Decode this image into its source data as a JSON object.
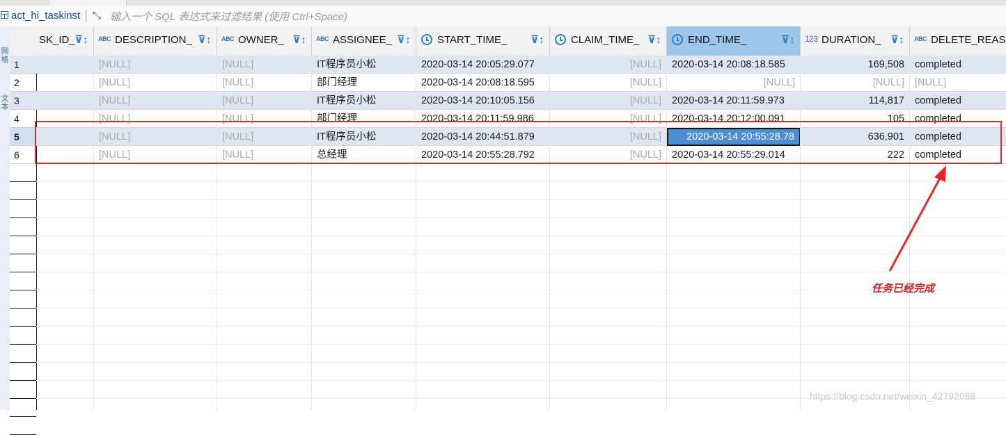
{
  "filter_bar": {
    "table_name": "act_hi_taskinst",
    "expand_icon": "expand-icon",
    "placeholder": "输入一个 SQL 表达式来过滤结果 (使用 Ctrl+Space)"
  },
  "sidebar": {
    "tab_1": "网格",
    "tab_2": "文本"
  },
  "columns": [
    {
      "name": "SK_ID_",
      "type": "text"
    },
    {
      "name": "DESCRIPTION_",
      "type": "text",
      "type_badge": "ABC"
    },
    {
      "name": "OWNER_",
      "type": "text",
      "type_badge": "ABC"
    },
    {
      "name": "ASSIGNEE_",
      "type": "text",
      "type_badge": "ABC"
    },
    {
      "name": "START_TIME_",
      "type": "datetime",
      "type_icon": "clock-icon"
    },
    {
      "name": "CLAIM_TIME_",
      "type": "datetime",
      "type_icon": "clock-icon"
    },
    {
      "name": "END_TIME_",
      "type": "datetime",
      "type_icon": "clock-icon",
      "active": true
    },
    {
      "name": "DURATION_",
      "type": "number",
      "type_badge": "123"
    },
    {
      "name": "DELETE_REASO",
      "type": "text",
      "type_badge": "ABC"
    }
  ],
  "rows": [
    {
      "num": "1",
      "cells": [
        "",
        "[NULL]",
        "[NULL]",
        "IT程序员小松",
        "2020-03-14 20:05:29.077",
        "[NULL]",
        "2020-03-14 20:08:18.585",
        "169,508",
        "completed"
      ]
    },
    {
      "num": "2",
      "cells": [
        "",
        "[NULL]",
        "[NULL]",
        "部门经理",
        "2020-03-14 20:08:18.595",
        "[NULL]",
        "[NULL]",
        "[NULL]",
        "[NULL]"
      ]
    },
    {
      "num": "3",
      "cells": [
        "",
        "[NULL]",
        "[NULL]",
        "IT程序员小松",
        "2020-03-14 20:10:05.156",
        "[NULL]",
        "2020-03-14 20:11:59.973",
        "114,817",
        "completed"
      ]
    },
    {
      "num": "4",
      "cells": [
        "",
        "[NULL]",
        "[NULL]",
        "部门经理",
        "2020-03-14 20:11:59.986",
        "[NULL]",
        "2020-03-14 20:12:00.091",
        "105",
        "completed"
      ]
    },
    {
      "num": "5",
      "cells": [
        "",
        "[NULL]",
        "[NULL]",
        "IT程序员小松",
        "2020-03-14 20:44:51.879",
        "[NULL]",
        "2020-03-14 20:55:28.78",
        "636,901",
        "completed"
      ],
      "selected": true
    },
    {
      "num": "6",
      "cells": [
        "",
        "[NULL]",
        "[NULL]",
        "总经理",
        "2020-03-14 20:55:28.792",
        "[NULL]",
        "2020-03-14 20:55:29.014",
        "222",
        "completed"
      ]
    }
  ],
  "annotation": {
    "text": "任务已经完成",
    "color": "#d41e24"
  },
  "watermark": "https://blog.csdn.net/weixin_42792088"
}
